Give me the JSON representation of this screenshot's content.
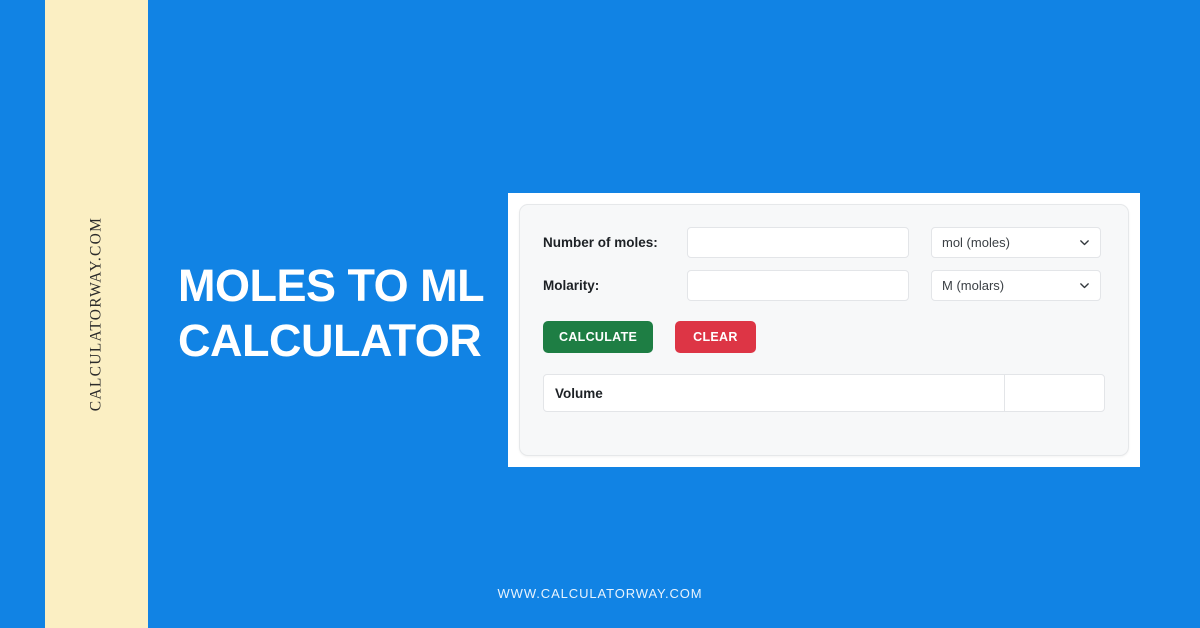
{
  "brand": {
    "side_band_text": "CALCULATORWAY.COM",
    "footer_url": "WWW.CALCULATORWAY.COM"
  },
  "headline": {
    "line1": "MOLES TO ML",
    "line2": "CALCULATOR",
    "full": "MOLES TO ML CALCULATOR"
  },
  "calculator": {
    "fields": [
      {
        "label": "Number of moles:",
        "value": "",
        "placeholder": "",
        "unit": "mol (moles)",
        "unit_icon": "chevron-down-icon"
      },
      {
        "label": "Molarity:",
        "value": "",
        "placeholder": "",
        "unit": "M (molars)",
        "unit_icon": "chevron-down-icon"
      }
    ],
    "buttons": {
      "calculate": "CALCULATE",
      "clear": "CLEAR"
    },
    "result": {
      "label": "Volume",
      "value": ""
    }
  },
  "colors": {
    "background_blue": "#1183e4",
    "side_band_cream": "#fbefc3",
    "card_surface": "#f7f8f9",
    "calculate_green": "#1e7e44",
    "clear_red": "#dd3545",
    "text_dark": "#1d2125",
    "text_white": "#ffffff"
  }
}
